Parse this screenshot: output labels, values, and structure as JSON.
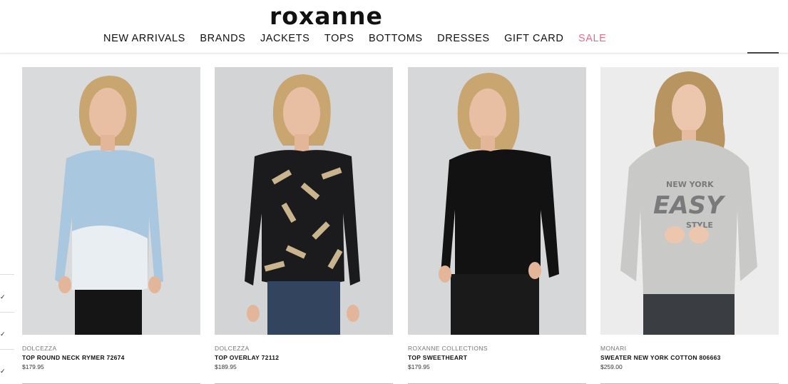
{
  "header": {
    "logo": "roxanne",
    "nav": [
      {
        "label": "NEW ARRIVALS"
      },
      {
        "label": "BRANDS"
      },
      {
        "label": "JACKETS"
      },
      {
        "label": "TOPS"
      },
      {
        "label": "BOTTOMS"
      },
      {
        "label": "DRESSES"
      },
      {
        "label": "GIFT CARD"
      },
      {
        "label": "SALE"
      }
    ],
    "sale_color": "#e0708a"
  },
  "products": [
    {
      "brand": "DOLCEZZA",
      "name": "TOP ROUND NECK RYMER 72674",
      "price": "$179.95",
      "top_color": "#a9c7df",
      "bg_color": "#d9dadc",
      "bottom_color": "#151515"
    },
    {
      "brand": "DOLCEZZA",
      "name": "TOP OVERLAY 72112",
      "price": "$189.95",
      "top_color": "#1b1b1d",
      "bg_color": "#d3d4d6",
      "bottom_color": "#33445e"
    },
    {
      "brand": "ROXANNE COLLECTIONS",
      "name": "TOP SWEETHEART",
      "price": "$179.95",
      "top_color": "#121212",
      "bg_color": "#d6d7d9",
      "bottom_color": "#1a1a1a"
    },
    {
      "brand": "MONARI",
      "name": "SWEATER NEW YORK COTTON 806663",
      "price": "$259.00",
      "top_color": "#c9c9c7",
      "bg_color": "#ececec",
      "bottom_color": "#3a3d42",
      "print_text": "NEW YORK EASY STYLE"
    }
  ]
}
